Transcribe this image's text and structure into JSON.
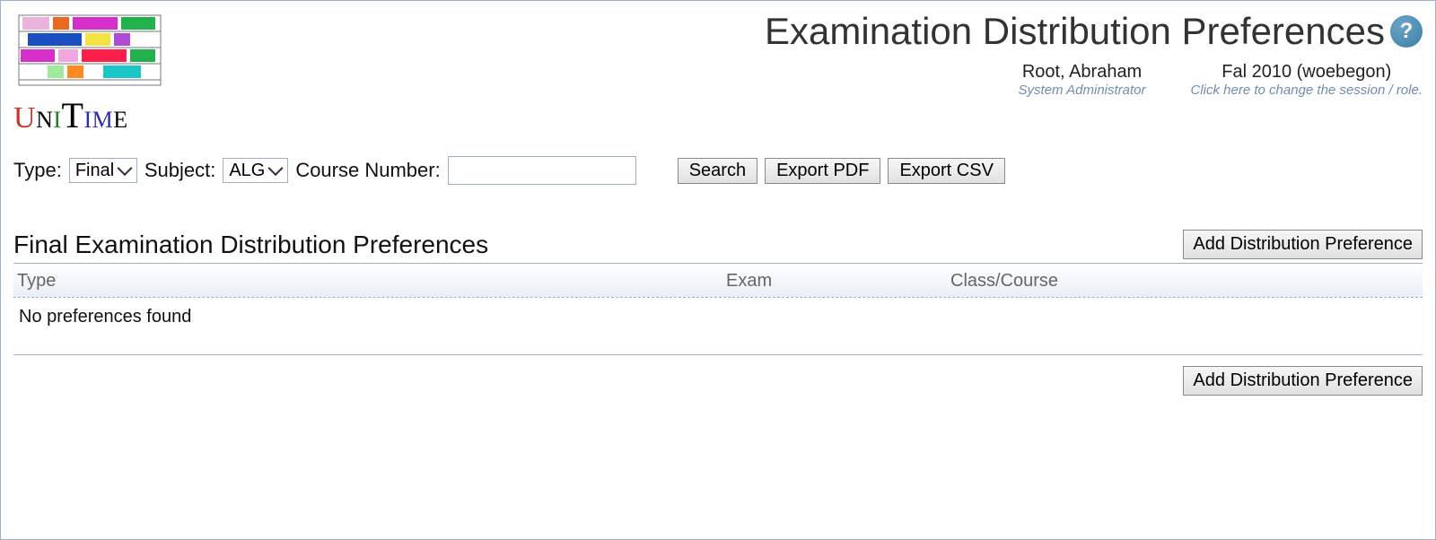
{
  "header": {
    "title": "Examination Distribution Preferences",
    "help_tooltip": "Help"
  },
  "identity": {
    "user_name": "Root, Abraham",
    "user_role": "System Administrator",
    "session_name": "Fal 2010 (woebegon)",
    "session_hint": "Click here to change the session / role."
  },
  "toolbar": {
    "type_label": "Type:",
    "type_value": "Final",
    "subject_label": "Subject:",
    "subject_value": "ALG",
    "course_number_label": "Course Number:",
    "course_number_value": "",
    "search_label": "Search",
    "export_pdf_label": "Export PDF",
    "export_csv_label": "Export CSV"
  },
  "section": {
    "title": "Final Examination Distribution Preferences",
    "add_button_label": "Add Distribution Preference"
  },
  "table": {
    "columns": {
      "type": "Type",
      "exam": "Exam",
      "class_course": "Class/Course"
    },
    "empty_message": "No preferences found"
  }
}
